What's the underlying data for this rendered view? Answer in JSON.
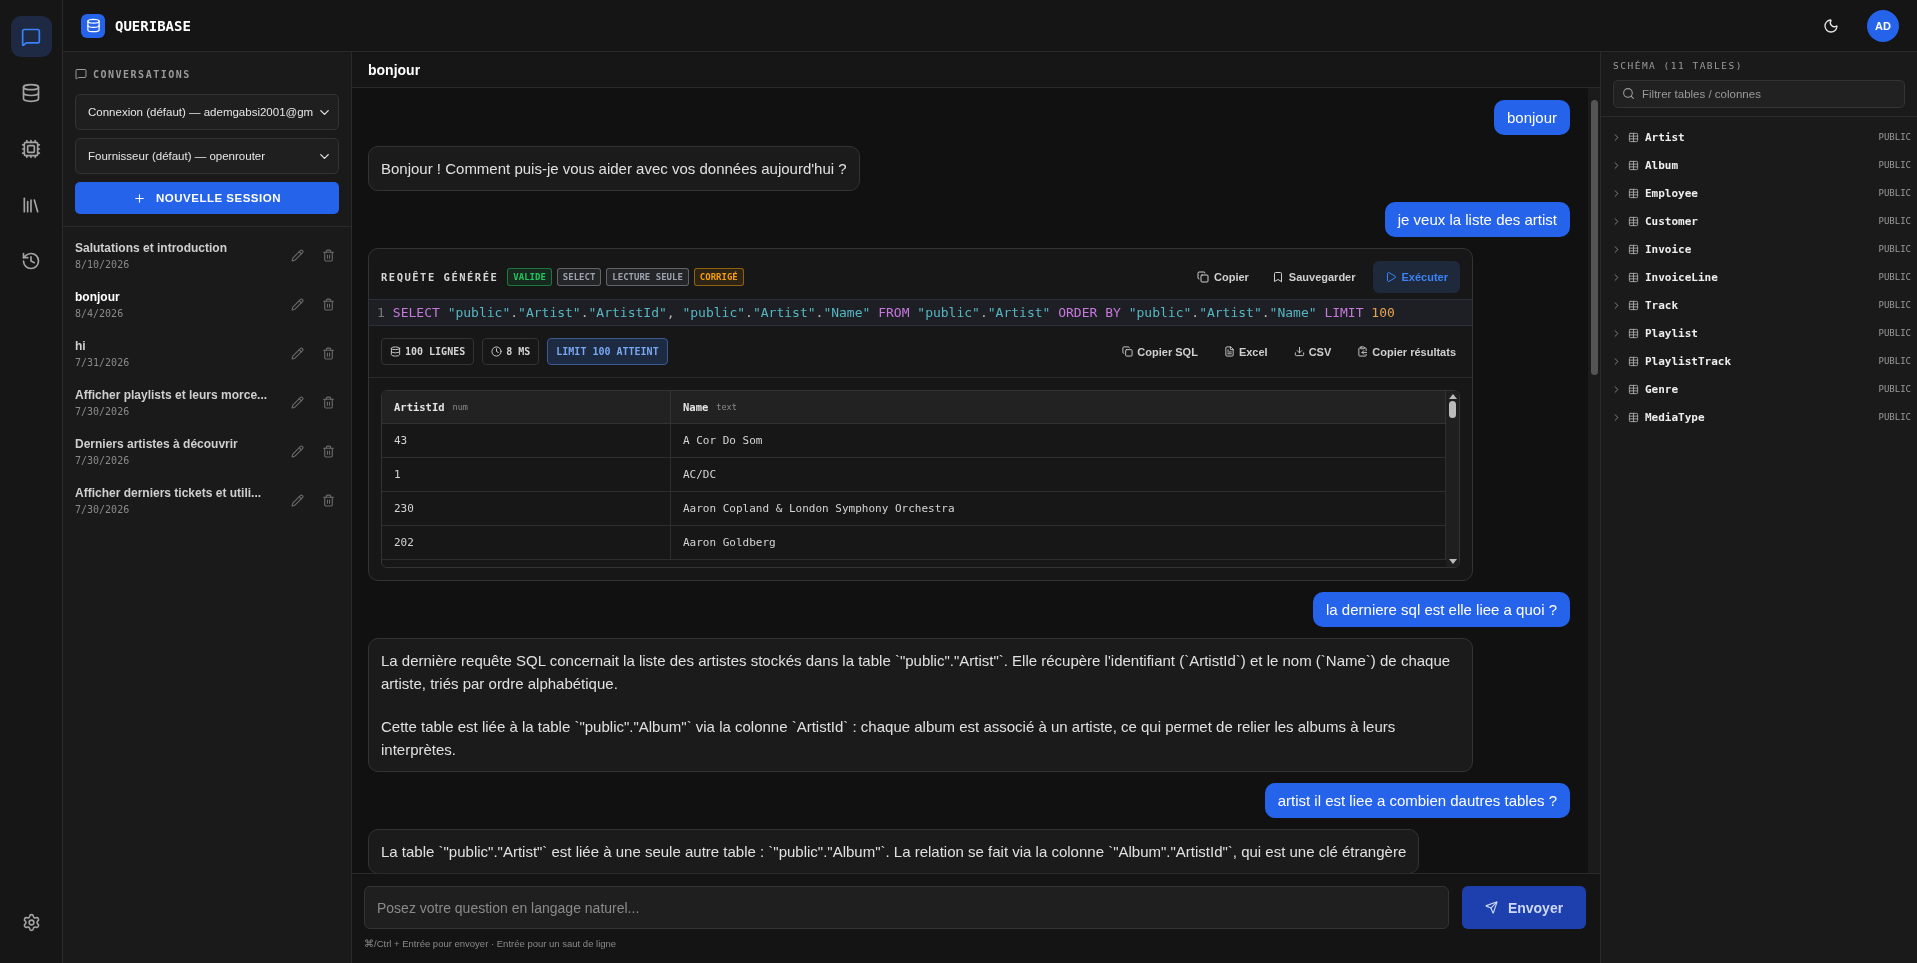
{
  "app": {
    "name": "QUERIBASE",
    "avatar": "AD"
  },
  "rail": [
    {
      "kind": "chat",
      "selected": true
    },
    {
      "kind": "database",
      "selected": false
    },
    {
      "kind": "cpu",
      "selected": false
    },
    {
      "kind": "library",
      "selected": false
    },
    {
      "kind": "history",
      "selected": false
    }
  ],
  "sidebar": {
    "title": "CONVERSATIONS",
    "connection": "Connexion (défaut) — ademgabsi2001@gm",
    "provider": "Fournisseur (défaut) — openrouter",
    "new_button": "NOUVELLE SESSION",
    "sessions": [
      {
        "title": "Salutations et introduction",
        "date": "8/10/2026",
        "selected": false
      },
      {
        "title": "bonjour",
        "date": "8/4/2026",
        "selected": true
      },
      {
        "title": "hi",
        "date": "7/31/2026",
        "selected": false
      },
      {
        "title": "Afficher playlists et leurs morce...",
        "date": "7/30/2026",
        "selected": false
      },
      {
        "title": "Derniers artistes à découvrir",
        "date": "7/30/2026",
        "selected": false
      },
      {
        "title": "Afficher derniers tickets et utili...",
        "date": "7/30/2026",
        "selected": false
      }
    ]
  },
  "chat": {
    "title": "bonjour",
    "messages": [
      {
        "kind": "user",
        "text": "bonjour"
      },
      {
        "kind": "assistant",
        "paragraphs": [
          "Bonjour ! Comment puis-je vous aider avec vos données aujourd'hui ?"
        ]
      },
      {
        "kind": "user",
        "text": "je veux la liste des artist"
      },
      {
        "kind": "query",
        "title": "REQUÊTE GÉNÉRÉE",
        "badges": [
          {
            "label": "VALIDE",
            "color": "#22c55e"
          },
          {
            "label": "SELECT",
            "color": "#9ca3af"
          },
          {
            "label": "LECTURE SEULE",
            "color": "#9ca3af"
          },
          {
            "label": "CORRIGÉ",
            "color": "#f59e0b"
          }
        ],
        "actions": [
          {
            "kind": "copy",
            "label": "Copier"
          },
          {
            "kind": "save",
            "label": "Sauvegarder"
          },
          {
            "kind": "run",
            "label": "Exécuter"
          }
        ],
        "line_number": "1",
        "sql": [
          {
            "kind": "keyword",
            "text": "SELECT"
          },
          {
            "kind": "string",
            "text": "\"public\""
          },
          {
            "kind": "plain",
            "text": "."
          },
          {
            "kind": "string",
            "text": "\"Artist\""
          },
          {
            "kind": "plain",
            "text": "."
          },
          {
            "kind": "string",
            "text": "\"ArtistId\""
          },
          {
            "kind": "plain",
            "text": ","
          },
          {
            "kind": "string",
            "text": "\"public\""
          },
          {
            "kind": "plain",
            "text": "."
          },
          {
            "kind": "string",
            "text": "\"Artist\""
          },
          {
            "kind": "plain",
            "text": "."
          },
          {
            "kind": "string",
            "text": "\"Name\""
          },
          {
            "kind": "keyword",
            "text": "FROM"
          },
          {
            "kind": "string",
            "text": "\"public\""
          },
          {
            "kind": "plain",
            "text": "."
          },
          {
            "kind": "string",
            "text": "\"Artist\""
          },
          {
            "kind": "keyword",
            "text": "ORDER BY"
          },
          {
            "kind": "string",
            "text": "\"public\""
          },
          {
            "kind": "plain",
            "text": "."
          },
          {
            "kind": "string",
            "text": "\"Artist\""
          },
          {
            "kind": "plain",
            "text": "."
          },
          {
            "kind": "string",
            "text": "\"Name\""
          },
          {
            "kind": "keyword",
            "text": "LIMIT"
          },
          {
            "kind": "number",
            "text": "100"
          }
        ],
        "stats": [
          {
            "kind": "rows",
            "label": "100 LIGNES"
          },
          {
            "kind": "time",
            "label": "8 MS"
          },
          {
            "kind": "limit",
            "label": "LIMIT 100 ATTEINT"
          }
        ],
        "exports": [
          {
            "kind": "copy",
            "label": "Copier SQL"
          },
          {
            "kind": "file",
            "label": "Excel"
          },
          {
            "kind": "download",
            "label": "CSV"
          },
          {
            "kind": "clipboard",
            "label": "Copier résultats"
          }
        ],
        "columns": [
          {
            "name": "ArtistId",
            "type": "num"
          },
          {
            "name": "Name",
            "type": "text"
          }
        ],
        "rows": [
          [
            "43",
            "A Cor Do Som"
          ],
          [
            "1",
            "AC/DC"
          ],
          [
            "230",
            "Aaron Copland & London Symphony Orchestra"
          ],
          [
            "202",
            "Aaron Goldberg"
          ]
        ]
      },
      {
        "kind": "user",
        "text": "la derniere sql est elle liee a quoi ?"
      },
      {
        "kind": "assistant",
        "paragraphs": [
          "La dernière requête SQL concernait la liste des artistes stockés dans la table `\"public\".\"Artist\"`. Elle récupère l'identifiant (`ArtistId`) et le nom (`Name`) de chaque artiste, triés par ordre alphabétique.",
          "Cette table est liée à la table `\"public\".\"Album\"` via la colonne `ArtistId` : chaque album est associé à un artiste, ce qui permet de relier les albums à leurs interprètes."
        ]
      },
      {
        "kind": "user",
        "text": "artist il est liee a combien dautres tables ?"
      },
      {
        "kind": "assistant",
        "paragraphs": [
          "La table `\"public\".\"Artist\"` est liée à une seule autre table : `\"public\".\"Album\"`. La relation se fait via la colonne `\"Album\".\"ArtistId\"`, qui est une clé étrangère"
        ]
      }
    ]
  },
  "composer": {
    "placeholder": "Posez votre question en langage naturel...",
    "button": "Envoyer",
    "hint": "⌘/Ctrl + Entrée pour envoyer · Entrée pour un saut de ligne"
  },
  "schema": {
    "title": "SCHÉMA (11 TABLES)",
    "filter_placeholder": "Filtrer tables / colonnes",
    "tables": [
      {
        "name": "Artist",
        "schema": "PUBLIC"
      },
      {
        "name": "Album",
        "schema": "PUBLIC"
      },
      {
        "name": "Employee",
        "schema": "PUBLIC"
      },
      {
        "name": "Customer",
        "schema": "PUBLIC"
      },
      {
        "name": "Invoice",
        "schema": "PUBLIC"
      },
      {
        "name": "InvoiceLine",
        "schema": "PUBLIC"
      },
      {
        "name": "Track",
        "schema": "PUBLIC"
      },
      {
        "name": "Playlist",
        "schema": "PUBLIC"
      },
      {
        "name": "PlaylistTrack",
        "schema": "PUBLIC"
      },
      {
        "name": "Genre",
        "schema": "PUBLIC"
      },
      {
        "name": "MediaType",
        "schema": "PUBLIC"
      }
    ]
  }
}
